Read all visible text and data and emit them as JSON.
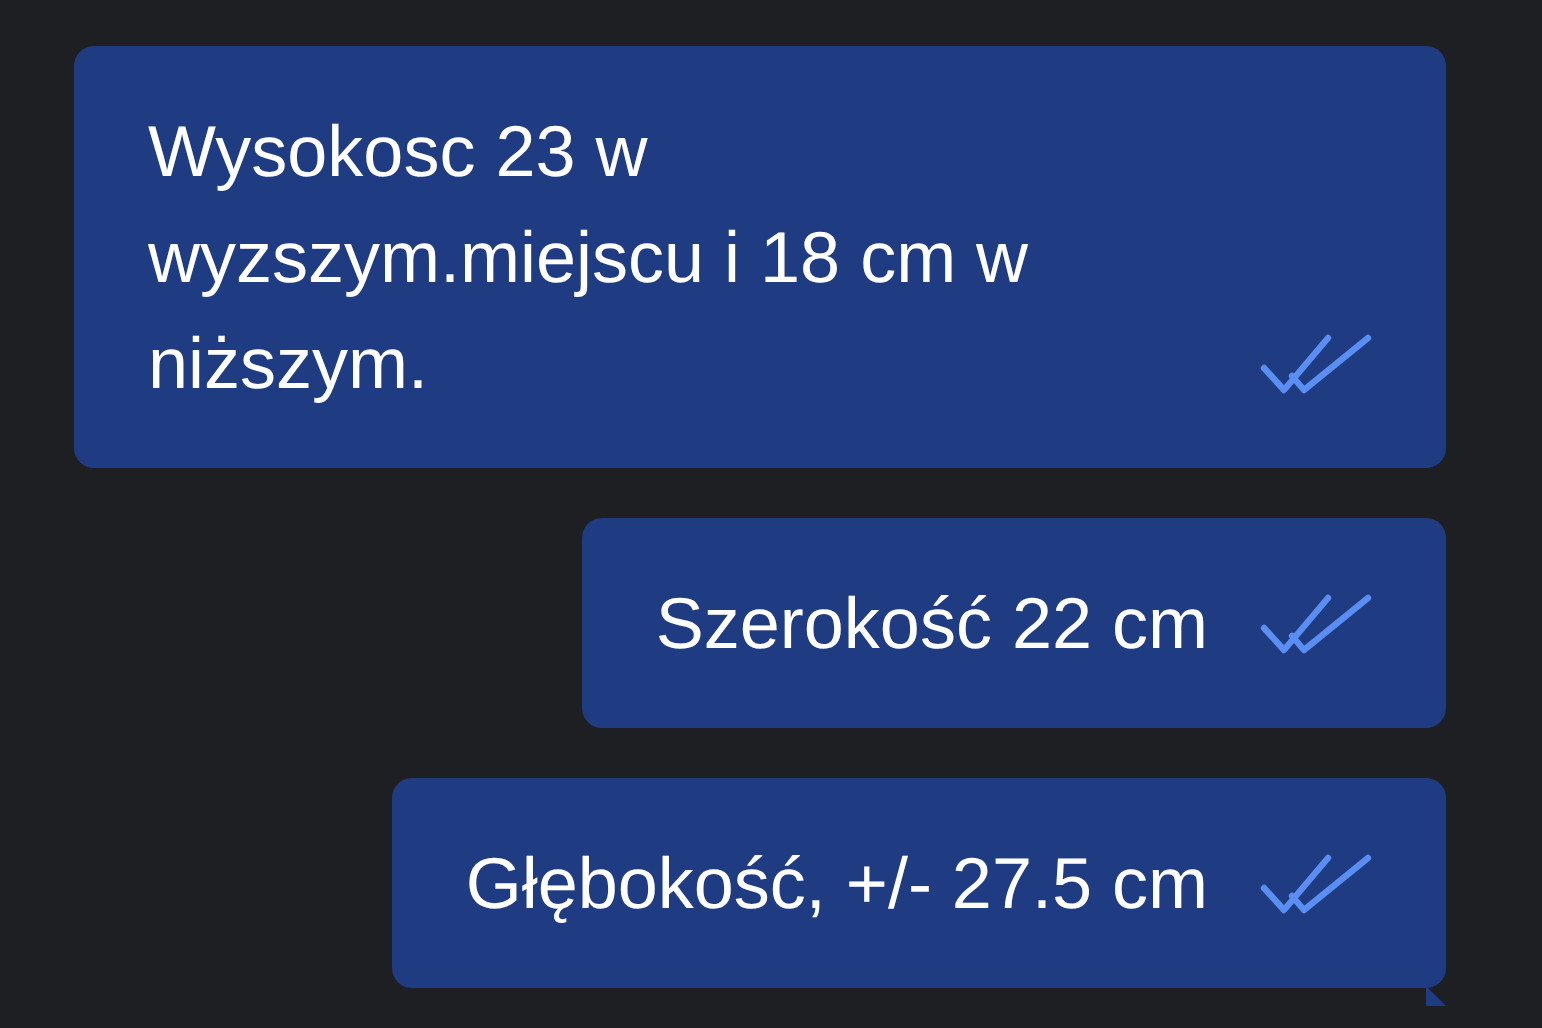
{
  "messages": [
    {
      "text": "Wysokosc 23 w wyzszym.miejscu i 18 cm w niższym.",
      "read": true,
      "tail": false
    },
    {
      "text": "Szerokość 22 cm",
      "read": true,
      "tail": false
    },
    {
      "text": "Głębokość, +/- 27.5 cm",
      "read": true,
      "tail": true
    }
  ]
}
